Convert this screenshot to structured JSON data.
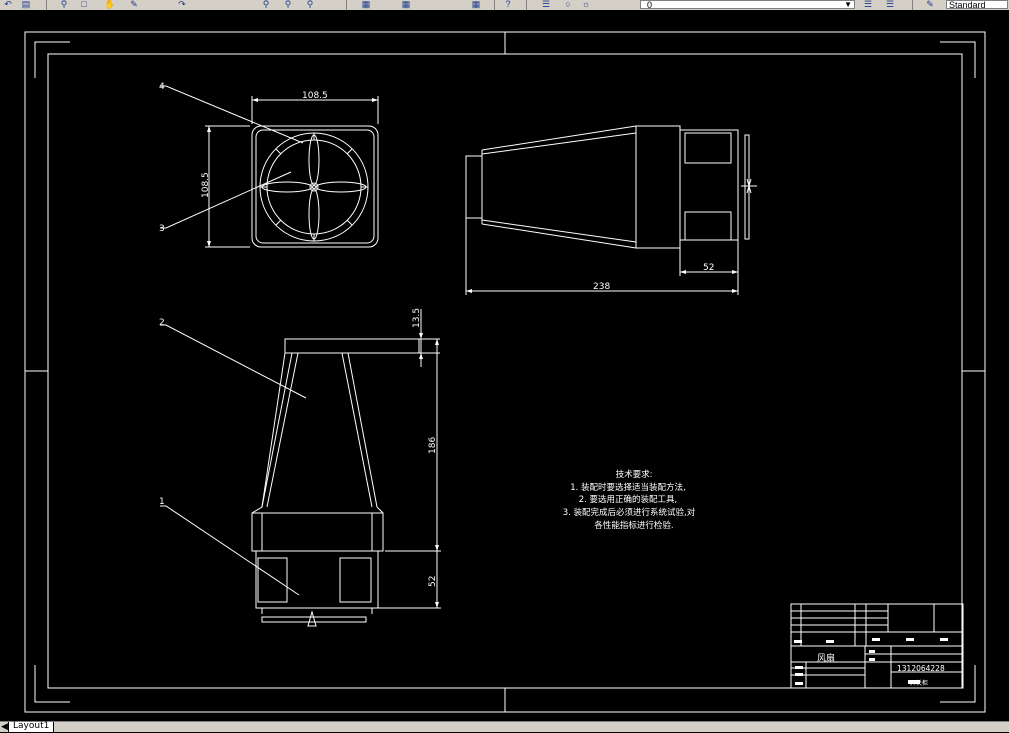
{
  "toolbar": {
    "icons": [
      "undo-icon",
      "open-icon",
      "zoom-realtime-icon",
      "zoom-window-icon",
      "pan-icon",
      "match-properties-icon",
      "redo-icon",
      "layer-icon",
      "lightbulb-icon",
      "properties-icon",
      "help-icon"
    ],
    "text_style": "Standard",
    "layer_value": "0"
  },
  "drawing": {
    "dims": {
      "top_width": "108.5",
      "top_height": "108.5",
      "side_length": "238",
      "side_motor": "52",
      "front_top": "13.5",
      "front_body": "186",
      "front_motor": "52"
    },
    "leaders": [
      "4",
      "3",
      "2",
      "1"
    ],
    "tech_req": {
      "title": "技术要求:",
      "line1": "1. 装配时要选择适当装配方法,",
      "line2": "2. 要选用正确的装配工具,",
      "line3": "3. 装配完成后必须进行系统试验,对",
      "line4": "各性能指标进行检验."
    },
    "title_block": {
      "name": "风扇",
      "drawing_no": "1312064228",
      "sub": "开关柜"
    }
  },
  "status": {
    "layout_tab": "Layout1"
  }
}
